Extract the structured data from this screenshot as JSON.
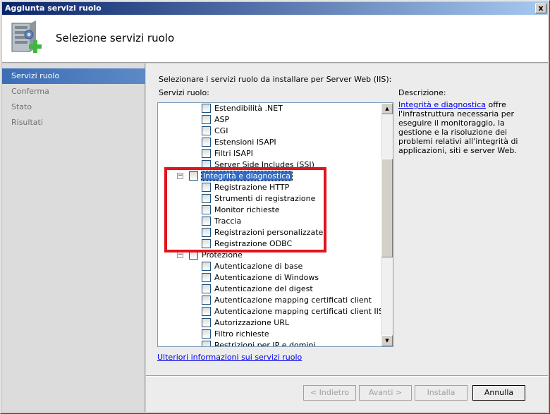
{
  "window": {
    "title": "Aggiunta servizi ruolo",
    "close_glyph": "x"
  },
  "header": {
    "title": "Selezione servizi ruolo",
    "icon": "server-add-icon"
  },
  "sidebar": {
    "items": [
      {
        "label": "Servizi ruolo",
        "active": true
      },
      {
        "label": "Conferma",
        "active": false
      },
      {
        "label": "Stato",
        "active": false
      },
      {
        "label": "Risultati",
        "active": false
      }
    ]
  },
  "main": {
    "instruction": "Selezionare i servizi ruolo da installare per Server Web (IIS):",
    "role_services_label": "Servizi ruolo:",
    "description_label": "Descrizione:",
    "description_link": "Integrità e diagnostica",
    "description_text": " offre l'infrastruttura necessaria per eseguire il monitoraggio, la gestione e la risoluzione dei problemi relativi all'integrità di applicazioni, siti e server Web.",
    "more_info_link": "Ulteriori informazioni sui servizi ruolo"
  },
  "tree": {
    "items": [
      {
        "label": "Estendibilità .NET",
        "level": 2,
        "checked": false
      },
      {
        "label": "ASP",
        "level": 2,
        "checked": false
      },
      {
        "label": "CGI",
        "level": 2,
        "checked": false
      },
      {
        "label": "Estensioni ISAPI",
        "level": 2,
        "checked": false
      },
      {
        "label": "Filtri ISAPI",
        "level": 2,
        "checked": false
      },
      {
        "label": "Server Side Includes (SSI)",
        "level": 2,
        "checked": false
      },
      {
        "label": "Integrità e diagnostica",
        "level": 1,
        "checked": false,
        "expander": "−",
        "selected": true
      },
      {
        "label": "Registrazione HTTP",
        "level": 2,
        "checked": false
      },
      {
        "label": "Strumenti di registrazione",
        "level": 2,
        "checked": false
      },
      {
        "label": "Monitor richieste",
        "level": 2,
        "checked": false
      },
      {
        "label": "Traccia",
        "level": 2,
        "checked": false
      },
      {
        "label": "Registrazioni personalizzate",
        "level": 2,
        "checked": false
      },
      {
        "label": "Registrazione ODBC",
        "level": 2,
        "checked": false
      },
      {
        "label": "Protezione",
        "level": 1,
        "checked": false,
        "expander": "−"
      },
      {
        "label": "Autenticazione di base",
        "level": 2,
        "checked": false
      },
      {
        "label": "Autenticazione di Windows",
        "level": 2,
        "checked": false
      },
      {
        "label": "Autenticazione del digest",
        "level": 2,
        "checked": false
      },
      {
        "label": "Autenticazione mapping certificati client",
        "level": 2,
        "checked": false
      },
      {
        "label": "Autenticazione mapping certificati client IIS",
        "level": 2,
        "checked": false
      },
      {
        "label": "Autorizzazione URL",
        "level": 2,
        "checked": false
      },
      {
        "label": "Filtro richieste",
        "level": 2,
        "checked": false
      },
      {
        "label": "Restrizioni per IP e domini",
        "level": 2,
        "checked": false
      }
    ],
    "scroll_up_glyph": "▲",
    "scroll_down_glyph": "▼"
  },
  "buttons": {
    "back": "< Indietro",
    "next": "Avanti >",
    "install": "Installa",
    "cancel": "Annulla"
  },
  "colors": {
    "annotation_box": "#e0141e",
    "sidebar_active": "#3c6eb4",
    "link": "#0000ee"
  }
}
